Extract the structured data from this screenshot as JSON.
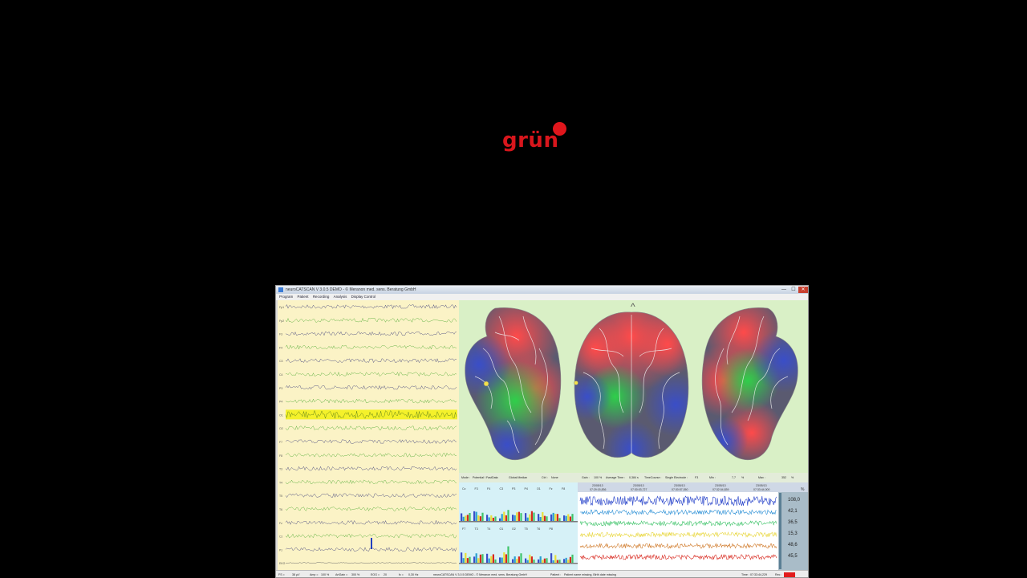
{
  "logo": {
    "text": "grün"
  },
  "window": {
    "title": "neuroCATSCAN V 3.0.5 DEMO - © Meranon med. sens. Beratung GmbH",
    "buttons": {
      "minimize": "—",
      "maximize": "☐",
      "close": "✕"
    }
  },
  "menu": [
    "Program",
    "Patient",
    "Recording",
    "Analysis",
    "Display Control"
  ],
  "eeg": {
    "channels": [
      "Fp1",
      "Fp2",
      "F3",
      "F4",
      "C3",
      "C4",
      "P3",
      "P4",
      "O1",
      "O2",
      "F7",
      "F8",
      "T3",
      "T4",
      "T5",
      "T6",
      "Fz",
      "Cz",
      "Pz",
      "EKG",
      "EOG"
    ]
  },
  "controls": {
    "mode_label": "Mode :",
    "mode_value": "Potential / FastData",
    "montage_value": "Global Median",
    "ctrl_label": "Ctrl :",
    "ctrl_value": "None",
    "gain_label": "Gain :",
    "gain_value": "100 %",
    "avg_label": "Average Time :",
    "avg_value": "0,384 s",
    "timecourse_label": "TimeCourse :",
    "timecourse_value": "Single Electrode :",
    "electrode": "F3",
    "min_label": "Min :",
    "min_value": "7,7",
    "min_unit": "%",
    "max_label": "Max :",
    "max_value": "352",
    "max_unit": "%"
  },
  "bars": {
    "top_labels": [
      "Cz",
      "F3",
      "F4",
      "C3",
      "P3",
      "P4",
      "O1",
      "Fz",
      "F8"
    ],
    "bottom_labels": [
      "F7",
      "T3",
      "T4",
      "O1",
      "O2",
      "T5",
      "T6",
      "P8"
    ]
  },
  "trend": {
    "unit": "%",
    "timestamps": [
      {
        "date": "23/05/13",
        "time": "07:29:15,836"
      },
      {
        "date": "23/05/13",
        "time": "07:30:03,727"
      },
      {
        "date": "23/05/13",
        "time": "07:30:57,050"
      },
      {
        "date": "23/05/13",
        "time": "07:32:04,839"
      },
      {
        "date": "23/05/13",
        "time": "07:33:44,000"
      }
    ],
    "row_values": [
      "108,0",
      "42,1",
      "36,5",
      "15,3",
      "48,6",
      "45,5"
    ],
    "colors": [
      "#1f3cc8",
      "#2a8fd6",
      "#3fc46a",
      "#e8d63a",
      "#d07a2a",
      "#d8281e"
    ]
  },
  "status": {
    "scale_label": "FS =",
    "scale_value": "38 µV",
    "amp_label": "Amp =",
    "amp_value": "100 %",
    "artgain_label": "ArtGain =",
    "artgain_value": "300 %",
    "eog_label": "EOG =",
    "eog_value": "20",
    "fc_label": "fc =",
    "fc_value": "0,30 Hz",
    "copyright": "neuroCATSCAN V 3.0.5 DEMO - © Meranon med. sens. Beratung GmbH",
    "patient_label": "Patient :",
    "patient_value": "Patient name missing, Birth date missing",
    "time_label": "Time :",
    "time_value": "07:33:44,229",
    "rec_label": "Rec :"
  }
}
